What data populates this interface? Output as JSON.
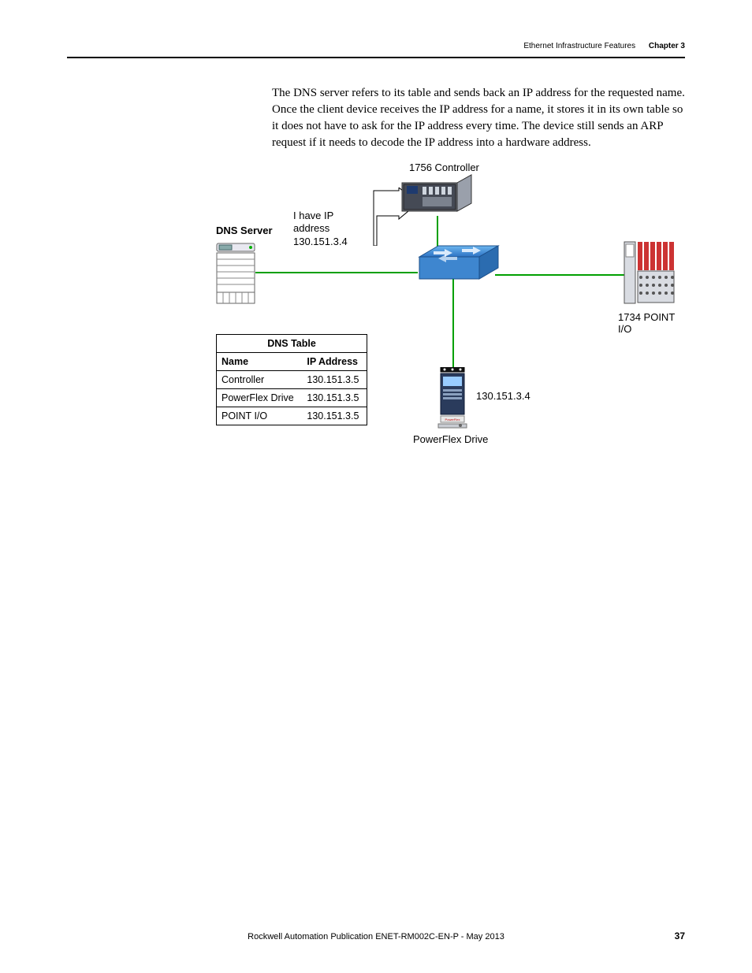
{
  "header": {
    "title": "Ethernet Infrastructure Features",
    "chapter": "Chapter 3"
  },
  "body": {
    "paragraph": "The DNS server refers to its table and sends back an IP address for the requested name. Once the client device receives the IP address for a name, it stores it in its own table so it does not have to ask for the IP address every time. The device still sends an ARP request if it needs to decode the IP address into a hardware address."
  },
  "figure": {
    "controller_label": "1756 Controller",
    "dns_server_label": "DNS Server",
    "callout_line1": "I have IP address",
    "callout_line2": "130.151.3.4",
    "pointio_label": "1734 POINT I/O",
    "drive_ip": "130.151.3.4",
    "drive_label": "PowerFlex Drive",
    "dns_table": {
      "title": "DNS Table",
      "headers": {
        "name": "Name",
        "ip": "IP Address"
      },
      "rows": [
        {
          "name": "Controller",
          "ip": "130.151.3.5"
        },
        {
          "name": "PowerFlex Drive",
          "ip": "130.151.3.5"
        },
        {
          "name": "POINT I/O",
          "ip": "130.151.3.5"
        }
      ]
    }
  },
  "footer": {
    "pub": "Rockwell Automation Publication ENET-RM002C-EN-P - May 2013",
    "page": "37"
  },
  "chart_data": {
    "type": "table",
    "title": "DNS Table",
    "columns": [
      "Name",
      "IP Address"
    ],
    "rows": [
      [
        "Controller",
        "130.151.3.5"
      ],
      [
        "PowerFlex Drive",
        "130.151.3.5"
      ],
      [
        "POINT I/O",
        "130.151.3.5"
      ]
    ]
  }
}
